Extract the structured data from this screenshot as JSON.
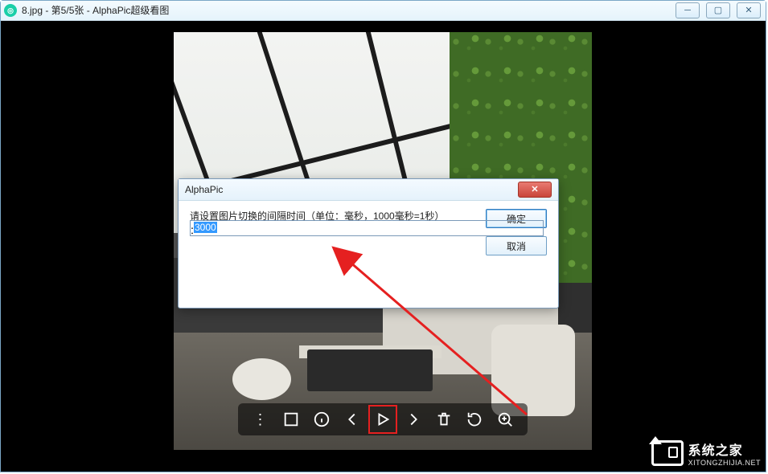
{
  "window": {
    "title": "8.jpg - 第5/5张 - AlphaPic超级看图",
    "app_icon_label": "AlphaPic"
  },
  "dialog": {
    "title": "AlphaPic",
    "prompt_line1": "请设置图片切换的间隔时间（单位：毫秒，1000毫秒=1秒）",
    "prompt_line2": "：",
    "input_value": "3000",
    "ok_label": "确定",
    "cancel_label": "取消"
  },
  "toolbar": {
    "more": "更多",
    "actual_size": "1:1",
    "info": "信息",
    "prev": "上一张",
    "play": "幻灯片播放",
    "next": "下一张",
    "delete": "删除",
    "rotate": "旋转",
    "zoom_in": "放大"
  },
  "watermark": {
    "cn": "系统之家",
    "en": "XITONGZHIJIA.NET"
  }
}
